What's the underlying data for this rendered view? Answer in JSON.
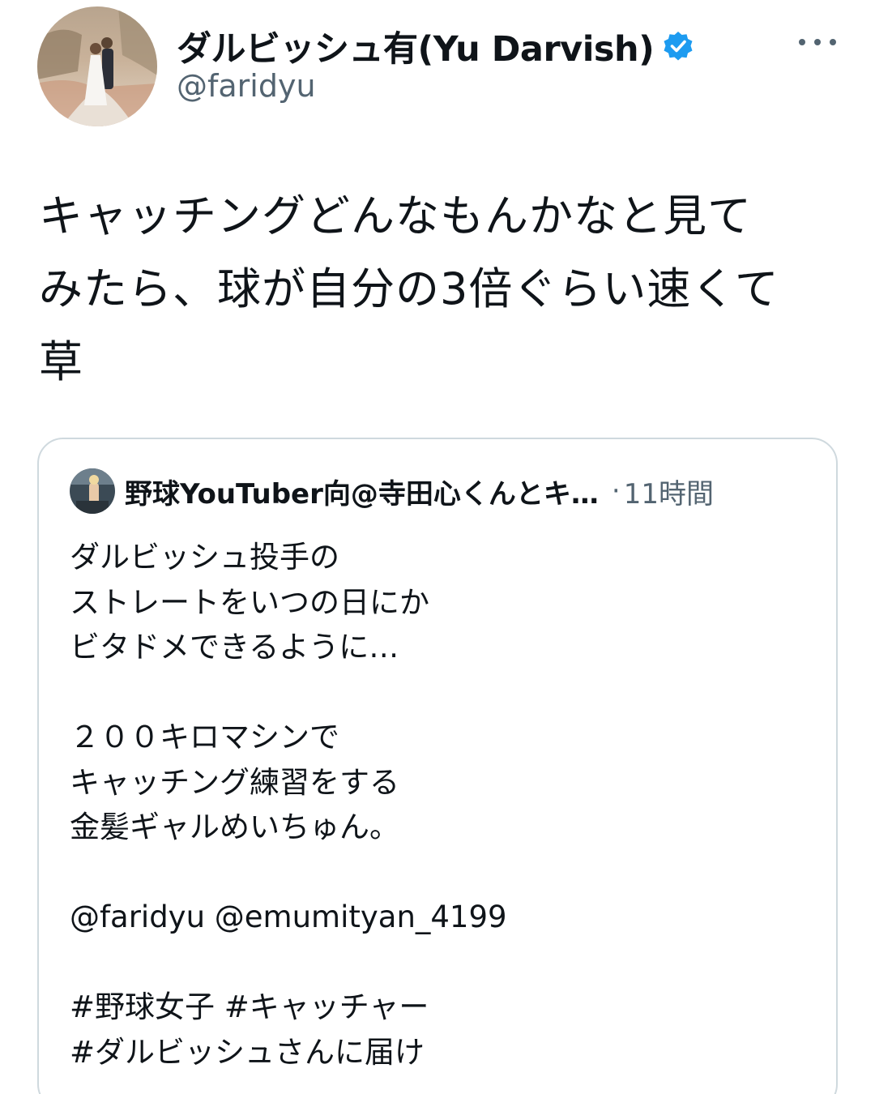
{
  "author": {
    "display_name": "ダルビッシュ有(Yu Darvish)",
    "handle": "@faridyu",
    "verified": true
  },
  "tweet": {
    "lines": [
      "キャッチングどんなもんかなと見て",
      "みたら、球が自分の3倍ぐらい速くて",
      "草"
    ]
  },
  "quoted": {
    "author_name": "野球YouTuber向@寺田心くんとキ…",
    "separator": "·",
    "time": "11時間",
    "lines": [
      "ダルビッシュ投手の",
      "ストレートをいつの日にか",
      "ビタドメできるように…",
      "",
      "２００キロマシンで",
      "キャッチング練習をする",
      "金髪ギャルめいちゅん。",
      "",
      "@faridyu @emumityan_4199",
      "",
      "#野球女子 #キャッチャー",
      "#ダルビッシュさんに届け"
    ]
  },
  "icons": {
    "verified": "verified-badge-icon",
    "more": "more-options-icon"
  },
  "colors": {
    "verified_blue": "#1d9bf0",
    "secondary_text": "#536471",
    "border": "#cfd9de"
  }
}
